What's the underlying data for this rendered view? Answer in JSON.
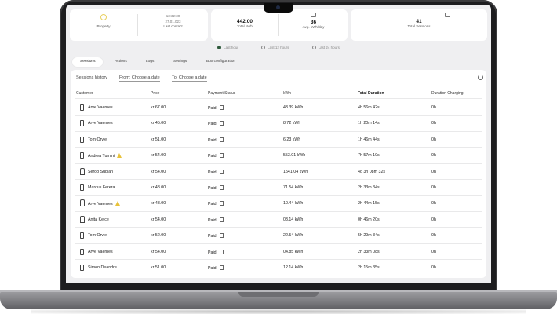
{
  "stats": {
    "property": {
      "label": "Property"
    },
    "last_contact": {
      "time": "13:32:30",
      "date": "27.01.023",
      "label": "Last contact"
    },
    "total_kwh": {
      "value": "442.00",
      "label": "Total kWh"
    },
    "avg_kwh_day": {
      "value": "36",
      "label": "Avg. kWh/day"
    },
    "total_sessions": {
      "value": "41",
      "label": "Total Sessions"
    }
  },
  "time_filters": [
    {
      "label": "Last hour",
      "selected": true
    },
    {
      "label": "Last 12 hours",
      "selected": false
    },
    {
      "label": "Last 24 hours",
      "selected": false
    }
  ],
  "tabs": [
    {
      "label": "Sessions",
      "active": true
    },
    {
      "label": "Actions",
      "active": false
    },
    {
      "label": "Logs",
      "active": false
    },
    {
      "label": "Settings",
      "active": false
    },
    {
      "label": "Box configuration",
      "active": false
    }
  ],
  "sessions": {
    "title": "Sessions history",
    "from_placeholder": "From: Choose a date",
    "to_placeholder": "To: Choose a date",
    "columns": [
      "Customer",
      "Price",
      "Payment Status",
      "kWh",
      "Total Duration",
      "Duration Charging"
    ],
    "rows": [
      {
        "icon": "phone-icon",
        "customer": "Arve Vaernes",
        "warning": false,
        "price": "kr 67.00",
        "status": "Paid",
        "kwh": "43.39 kWh",
        "total": "4h 56m 42s",
        "charging": "0h"
      },
      {
        "icon": "phone-icon",
        "customer": "Arve Vaernes",
        "warning": false,
        "price": "kr 45.00",
        "status": "Paid",
        "kwh": "8.72 kWh",
        "total": "1h 20m 14s",
        "charging": "0h"
      },
      {
        "icon": "phone-icon",
        "customer": "Tom Orviel",
        "warning": false,
        "price": "kr 51.00",
        "status": "Paid",
        "kwh": "6.23 kWh",
        "total": "1h 46m 44s",
        "charging": "0h"
      },
      {
        "icon": "phone-icon",
        "customer": "Andrea Tumini",
        "warning": true,
        "price": "kr 54.00",
        "status": "Paid",
        "kwh": "553.01 kWh",
        "total": "7h 57m 10s",
        "charging": "0h"
      },
      {
        "icon": "charger-icon",
        "customer": "Sergo Sublan",
        "warning": false,
        "price": "kr 54.00",
        "status": "Paid",
        "kwh": "1541.04 kWh",
        "total": "4d 3h 08m 32s",
        "charging": "0h"
      },
      {
        "icon": "phone-icon",
        "customer": "Marcus Ferera",
        "warning": false,
        "price": "kr 48.00",
        "status": "Paid",
        "kwh": "71.54 kWh",
        "total": "2h 33m 34s",
        "charging": "0h"
      },
      {
        "icon": "charger-icon",
        "customer": "Arve Vaernes",
        "warning": true,
        "price": "kr 48.00",
        "status": "Paid",
        "kwh": "10.44 kWh",
        "total": "2h 44m 15s",
        "charging": "0h"
      },
      {
        "icon": "charger-icon",
        "customer": "Anita Kelce",
        "warning": false,
        "price": "kr 54.00",
        "status": "Paid",
        "kwh": "03.14 kWh",
        "total": "0h 46m 20s",
        "charging": "0h"
      },
      {
        "icon": "phone-icon",
        "customer": "Tom Orviel",
        "warning": false,
        "price": "kr 52.00",
        "status": "Paid",
        "kwh": "22.54 kWh",
        "total": "5h 29m 34s",
        "charging": "0h"
      },
      {
        "icon": "phone-icon",
        "customer": "Arve Vaernes",
        "warning": false,
        "price": "kr 54.00",
        "status": "Paid",
        "kwh": "04.85 kWh",
        "total": "2h 33m 08s",
        "charging": "0h"
      },
      {
        "icon": "phone-icon",
        "customer": "Simon Deandre",
        "warning": false,
        "price": "kr 51.00",
        "status": "Paid",
        "kwh": "12.14 kWh",
        "total": "2h 15m 35s",
        "charging": "0h"
      }
    ]
  }
}
